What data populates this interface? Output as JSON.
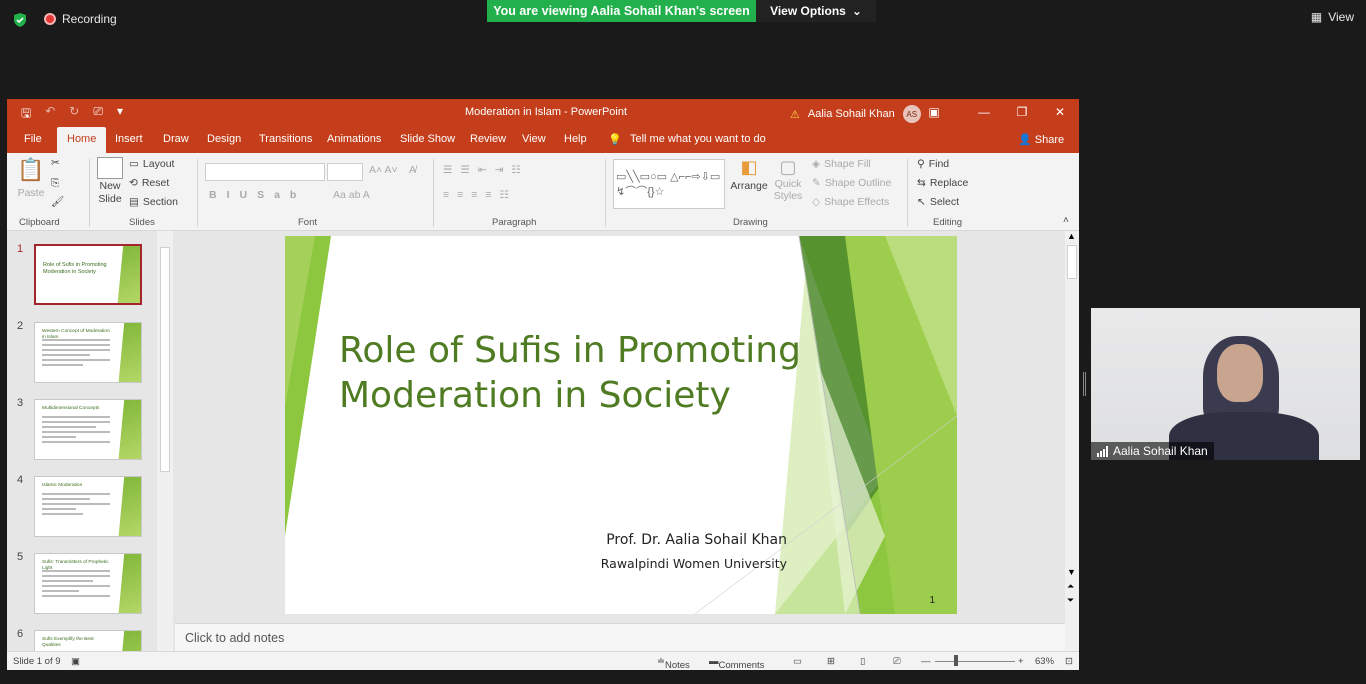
{
  "zoom": {
    "recording_label": "Recording",
    "viewing_banner": "You are viewing Aalia Sohail Khan's screen",
    "view_options_label": "View Options",
    "view_label": "View",
    "participant_name": "Aalia Sohail Khan"
  },
  "powerpoint": {
    "window_title": "Moderation in Islam  -  PowerPoint",
    "user_name": "Aalia Sohail Khan",
    "user_initials": "AS",
    "tabs": [
      "File",
      "Home",
      "Insert",
      "Draw",
      "Design",
      "Transitions",
      "Animations",
      "Slide Show",
      "Review",
      "View",
      "Help"
    ],
    "tell_me": "Tell me what you want to do",
    "share_label": "Share",
    "ribbon": {
      "clipboard": {
        "paste": "Paste",
        "label": "Clipboard"
      },
      "slides": {
        "new_slide": "New",
        "new_slide_2": "Slide",
        "layout": "Layout",
        "reset": "Reset",
        "section": "Section",
        "label": "Slides"
      },
      "font": {
        "label": "Font"
      },
      "paragraph": {
        "label": "Paragraph"
      },
      "drawing": {
        "arrange": "Arrange",
        "quick": "Quick",
        "styles": "Styles",
        "shape_fill": "Shape Fill",
        "shape_outline": "Shape Outline",
        "shape_effects": "Shape Effects",
        "label": "Drawing"
      },
      "editing": {
        "find": "Find",
        "replace": "Replace",
        "select": "Select",
        "label": "Editing"
      }
    },
    "thumbnails": [
      {
        "num": "1",
        "title": "Role of Sufis in Promoting Moderation in Society"
      },
      {
        "num": "2",
        "title": "Western Concept of Moderation in Islam"
      },
      {
        "num": "3",
        "title": "Multidimensional Concepts"
      },
      {
        "num": "4",
        "title": "Islamic Moderation"
      },
      {
        "num": "5",
        "title": "Sufis: Transmitters of Prophetic Light"
      },
      {
        "num": "6",
        "title": "Sufis Exemplify the Best Qualities"
      }
    ],
    "slide": {
      "title_line1": "Role of Sufis in Promoting",
      "title_line2": "Moderation in Society",
      "author": "Prof. Dr. Aalia Sohail Khan",
      "institution": "Rawalpindi Women University",
      "number": "1"
    },
    "notes_placeholder": "Click to add notes",
    "status": {
      "slide_counter": "Slide 1 of 9",
      "notes": "Notes",
      "comments": "Comments",
      "zoom": "63%"
    }
  }
}
